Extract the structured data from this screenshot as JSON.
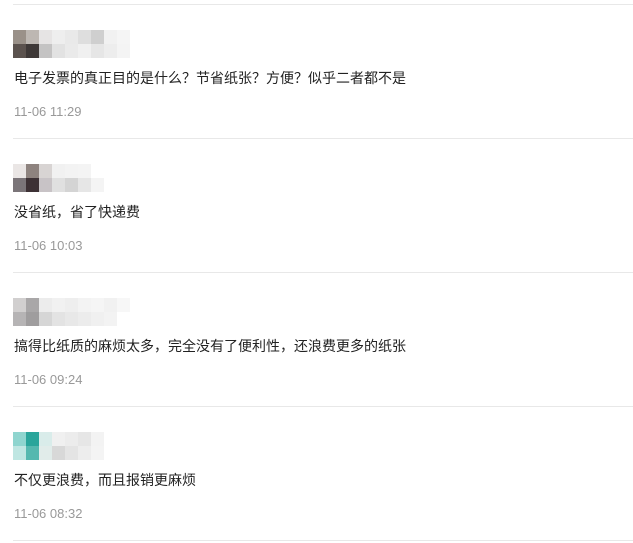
{
  "comments": [
    {
      "text": "电子发票的真正目的是什么？节省纸张？方便？似乎二者都不是",
      "time": "11-06 11:29",
      "avatar_colors": [
        "#9a9189",
        "#bdb7b2",
        "#e6e4e4",
        "#eeeeee",
        "#e9e9e9",
        "#dedede",
        "#cfcfcf",
        "#f1f1f1",
        "#f5f5f5",
        "#5b524e",
        "#3e3837",
        "#c4c3c3",
        "#e2e2e2",
        "#eaeaea",
        "#f0f0f0",
        "#e6e6e6",
        "#ededed",
        "#f4f4f4"
      ]
    },
    {
      "text": "没省纸，省了快递费",
      "time": "11-06 10:03",
      "avatar_colors": [
        "#eae6e5",
        "#8e837f",
        "#d8d4d3",
        "#f1f1f1",
        "#f3f3f3",
        "#f4f4f4",
        "#ffffff",
        "#ffffff",
        "#ffffff",
        "#7b7579",
        "#3d3135",
        "#c8c3c6",
        "#e0e0e0",
        "#d4d4d4",
        "#e6e6e6",
        "#f4f4f4",
        "#ffffff",
        "#ffffff"
      ]
    },
    {
      "text": "搞得比纸质的麻烦太多，完全没有了便利性，还浪费更多的纸张",
      "time": "11-06 09:24",
      "avatar_colors": [
        "#d1cfcf",
        "#a9a7a8",
        "#ececec",
        "#f1f1f1",
        "#eeeeee",
        "#f3f3f3",
        "#f5f5f5",
        "#f1f1f1",
        "#f7f7f7",
        "#b6b4b5",
        "#9f9d9e",
        "#d6d6d6",
        "#e3e3e3",
        "#e8e8e8",
        "#ececec",
        "#f0f0f0",
        "#f3f3f3",
        "#ffffff"
      ]
    },
    {
      "text": "不仅更浪费，而且报销更麻烦",
      "time": "11-06 08:32",
      "avatar_colors": [
        "#8fd5cf",
        "#2aa59b",
        "#d9ecea",
        "#f0f0f0",
        "#ececec",
        "#e6e6e6",
        "#f3f3f3",
        "#ffffff",
        "#ffffff",
        "#bfe6e2",
        "#55b8af",
        "#e1ecea",
        "#d8d8d8",
        "#e4e4e4",
        "#ededed",
        "#f4f4f4",
        "#ffffff",
        "#ffffff"
      ]
    }
  ]
}
